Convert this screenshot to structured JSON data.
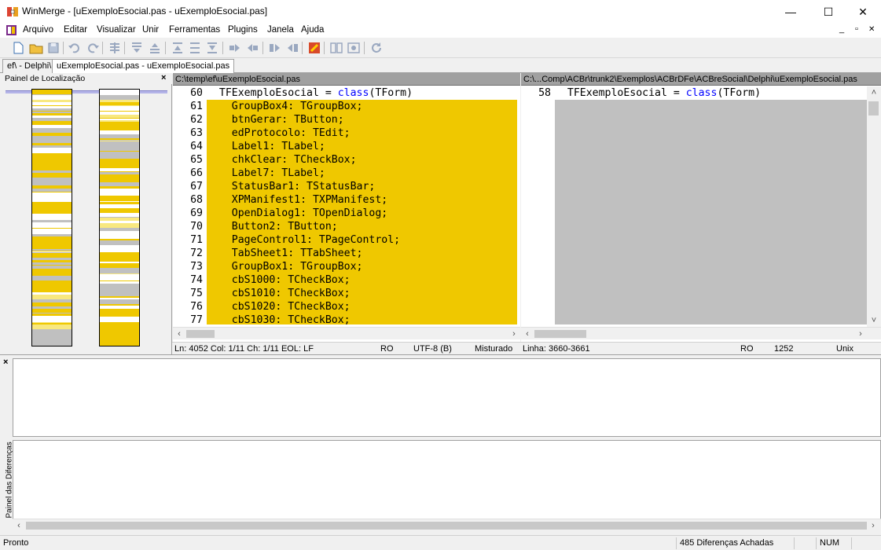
{
  "window": {
    "title": "WinMerge - [uExemploEsocial.pas - uExemploEsocial.pas]",
    "minimize": "—",
    "maximize": "☐",
    "close": "✕",
    "mdi_minimize": "_",
    "mdi_restore": "▫",
    "mdi_close": "✕"
  },
  "menu": [
    "Arquivo",
    "Editar",
    "Visualizar",
    "Unir",
    "Ferramentas",
    "Plugins",
    "Janela",
    "Ajuda"
  ],
  "tabs": [
    "ef\\ - Delphi\\",
    "uExemploEsocial.pas - uExemploEsocial.pas"
  ],
  "location_pane": {
    "title": "Painel de Localização",
    "close": "×"
  },
  "left": {
    "path": "C:\\temp\\ef\\uExemploEsocial.pas",
    "lines": [
      {
        "num": "60",
        "pre": "  TFExemploEsocial = ",
        "kw": "class",
        "post": "(TForm)",
        "diff": false
      },
      {
        "num": "61",
        "pre": "    GroupBox4: TGroupBox;",
        "diff": true
      },
      {
        "num": "62",
        "pre": "    btnGerar: TButton;",
        "diff": true
      },
      {
        "num": "63",
        "pre": "    edProtocolo: TEdit;",
        "diff": true
      },
      {
        "num": "64",
        "pre": "    Label1: TLabel;",
        "diff": true
      },
      {
        "num": "65",
        "pre": "    chkClear: TCheckBox;",
        "diff": true
      },
      {
        "num": "66",
        "pre": "    Label7: TLabel;",
        "diff": true
      },
      {
        "num": "67",
        "pre": "    StatusBar1: TStatusBar;",
        "diff": true
      },
      {
        "num": "68",
        "pre": "    XPManifest1: TXPManifest;",
        "diff": true
      },
      {
        "num": "69",
        "pre": "    OpenDialog1: TOpenDialog;",
        "diff": true
      },
      {
        "num": "70",
        "pre": "    Button2: TButton;",
        "diff": true
      },
      {
        "num": "71",
        "pre": "    PageControl1: TPageControl;",
        "diff": true
      },
      {
        "num": "72",
        "pre": "    TabSheet1: TTabSheet;",
        "diff": true
      },
      {
        "num": "73",
        "pre": "    GroupBox1: TGroupBox;",
        "diff": true
      },
      {
        "num": "74",
        "pre": "    cbS1000: TCheckBox;",
        "diff": true
      },
      {
        "num": "75",
        "pre": "    cbS1010: TCheckBox;",
        "diff": true
      },
      {
        "num": "76",
        "pre": "    cbS1020: TCheckBox;",
        "diff": true
      },
      {
        "num": "77",
        "pre": "    cbS1030: TCheckBox;",
        "diff": true
      }
    ]
  },
  "right": {
    "path": "C:\\...Comp\\ACBr\\trunk2\\Exemplos\\ACBrDFe\\ACBreSocial\\Delphi\\uExemploEsocial.pas",
    "lines": [
      {
        "num": "58",
        "pre": "  TFExemploEsocial = ",
        "kw": "class",
        "post": "(TForm)"
      }
    ]
  },
  "status_left": {
    "pos": "Ln: 4052  Col: 1/11  Ch: 1/11  EOL: LF",
    "ro": "RO",
    "enc": "UTF-8 (B)",
    "eol": "Misturado"
  },
  "status_right": {
    "pos": "Linha: 3660-3661",
    "ro": "RO",
    "enc": "1252",
    "eol": "Unix"
  },
  "diff_pane": {
    "close": "×",
    "label": "Painel das Diferenças"
  },
  "statusbar": {
    "text": "Pronto",
    "diffs": "485 Diferenças Achadas",
    "num": "NUM"
  },
  "colors": {
    "diff": "#efc800",
    "empty": "#c0c0c0",
    "keyword": "#0000ff"
  }
}
